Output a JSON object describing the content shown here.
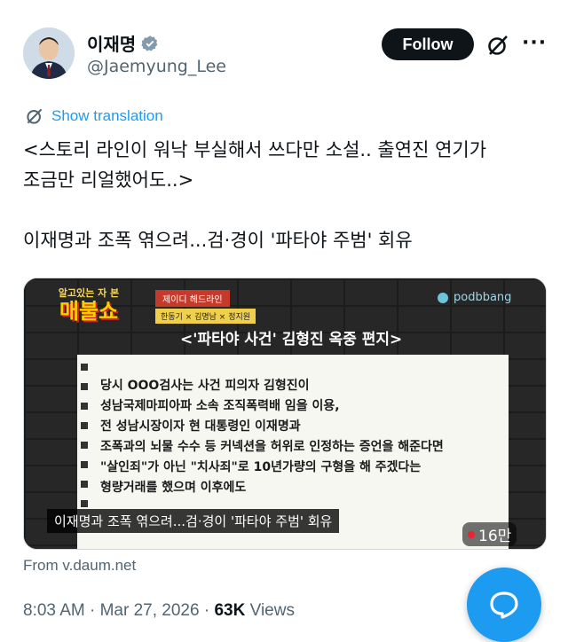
{
  "author": {
    "name": "이재명",
    "handle": "@Jaemyung_Lee",
    "verified": true
  },
  "actions": {
    "follow_label": "Follow",
    "grok_icon": "grok-icon",
    "more_icon": "more-icon"
  },
  "translate": {
    "label": "Show translation"
  },
  "post": {
    "lines": [
      "<스토리 라인이 워낙 부실해서 쓰다만 소설.. 출연진 연기가",
      "조금만 리얼했어도..>",
      "이재명과 조폭 엮으려...검·경이 '파타야 주범' 회유"
    ]
  },
  "media": {
    "show_top": "알고있는 자 본",
    "show_name": "매불쇼",
    "tag1": "제이디 헤드라인",
    "tag2": "한동기 × 김명남 × 정지원",
    "brand": "podbbang",
    "video_title": "<'파타야 사건' 김형진 옥중 편지>",
    "letter_lines": [
      "당시 OOO검사는 사건 피의자 김형진이",
      "성남국제마피아파 소속 조직폭력배 임을 이용,",
      "전 성남시장이자 현 대통령인 이재명과",
      "조폭과의 뇌물 수수 등 커넥션을 허위로 인정하는 증언을 해준다면",
      "\"살인죄\"가 아닌 \"치사죄\"로 10년가량의 구형을 해 주겠다는",
      "형량거래를 했으며 이후에도"
    ],
    "caption": "이재명과 조폭 엮으려...검·경이 '파타야 주범' 회유",
    "views": "16만"
  },
  "source": {
    "label": "From v.daum.net"
  },
  "meta": {
    "time": "8:03 AM",
    "date": "Mar 27, 2026",
    "views_count": "63K",
    "views_label": "Views"
  },
  "colors": {
    "accent": "#1d9bf0",
    "text": "#0f1419",
    "muted": "#536471"
  }
}
